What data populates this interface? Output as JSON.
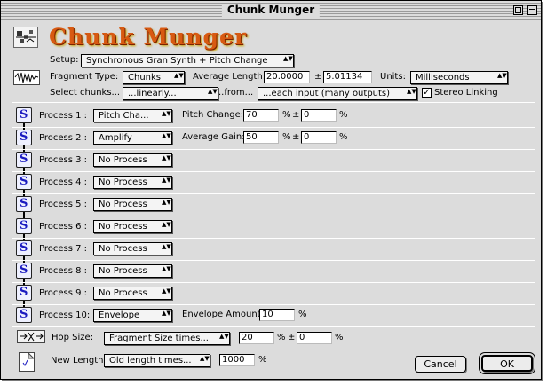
{
  "window": {
    "title": "Chunk Munger"
  },
  "header": {
    "app_title": "Chunk Munger"
  },
  "setup": {
    "label": "Setup:",
    "value": "Synchronous Gran Synth + Pitch Change"
  },
  "fragment": {
    "type_label": "Fragment Type:",
    "type_value": "Chunks",
    "avg_length_label": "Average Length:",
    "avg_length_value": "20.0000",
    "plusminus": "±",
    "avg_length_variance": "5.01134",
    "units_label": "Units:",
    "units_value": "Milliseconds"
  },
  "select_chunks": {
    "label": "Select chunks...",
    "mode_value": "...linearly...",
    "from_label": "..from...",
    "source_value": "...each input (many outputs)",
    "stereo_label": "Stereo Linking",
    "stereo_checked": "✓"
  },
  "processes": [
    {
      "label": "Process 1 :",
      "value": "Pitch Cha...",
      "param_label": "Pitch Change:",
      "param_value": "70",
      "unit1": "%",
      "pm": "±",
      "variance": "0",
      "unit2": "%"
    },
    {
      "label": "Process 2 :",
      "value": "Amplify",
      "param_label": "Average Gain:",
      "param_value": "50",
      "unit1": "%",
      "pm": "±",
      "variance": "0",
      "unit2": "%"
    },
    {
      "label": "Process 3 :",
      "value": "No Process"
    },
    {
      "label": "Process 4 :",
      "value": "No Process"
    },
    {
      "label": "Process 5 :",
      "value": "No Process"
    },
    {
      "label": "Process 6 :",
      "value": "No Process"
    },
    {
      "label": "Process 7 :",
      "value": "No Process"
    },
    {
      "label": "Process 8 :",
      "value": "No Process"
    },
    {
      "label": "Process 9 :",
      "value": "No Process"
    },
    {
      "label": "Process 10:",
      "value": "Envelope",
      "param_label": "Envelope Amount:",
      "param_value": "10",
      "unit1": "%"
    }
  ],
  "hop": {
    "label": "Hop Size:",
    "mode_value": "Fragment Size times...",
    "value": "20",
    "unit1": "%",
    "pm": "±",
    "variance": "0",
    "unit2": "%"
  },
  "new_length": {
    "label": "New Length:",
    "mode_value": "Old length times...",
    "value": "1000",
    "unit": "%"
  },
  "buttons": {
    "cancel": "Cancel",
    "ok": "OK"
  },
  "glyphs": {
    "popup_arrow": "▲▼"
  }
}
